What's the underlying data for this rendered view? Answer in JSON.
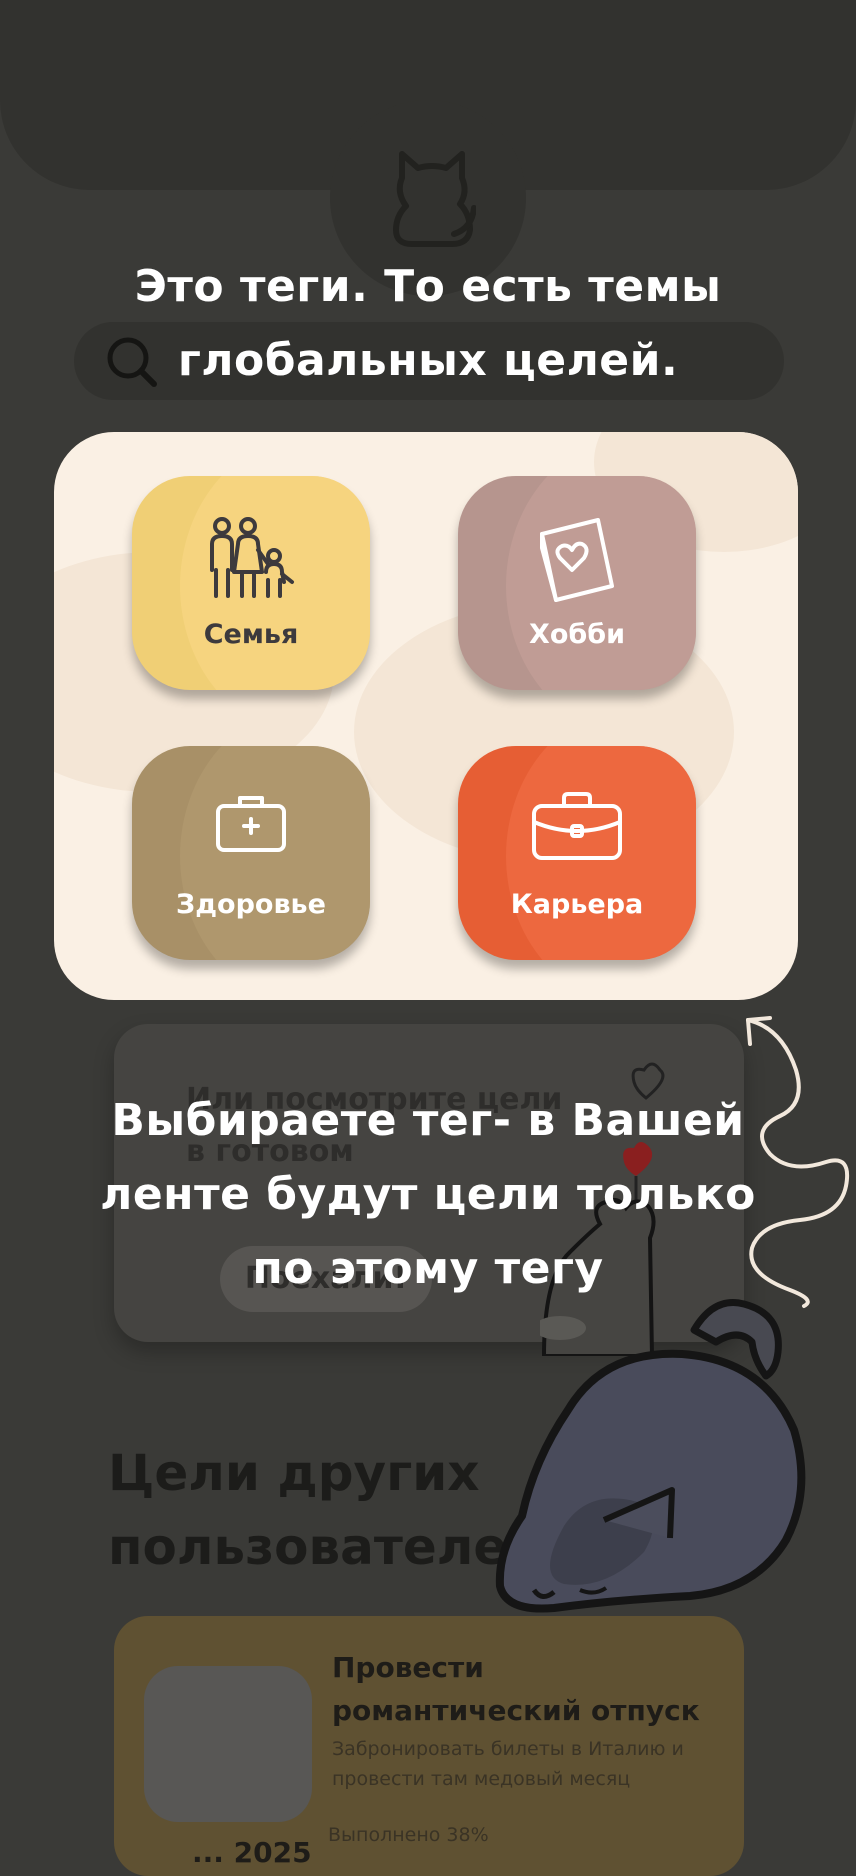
{
  "onboarding": {
    "tip_top": "Это теги. То есть темы глобальных целей.",
    "tip_bottom": "Выбираете тег- в Вашей ленте будут цели только по этому тегу"
  },
  "tags": [
    {
      "label": "Семья",
      "icon": "family-icon"
    },
    {
      "label": "Хобби",
      "icon": "book-heart-icon"
    },
    {
      "label": "Здоровье",
      "icon": "medical-kit-icon"
    },
    {
      "label": "Карьера",
      "icon": "briefcase-icon"
    }
  ],
  "promo": {
    "text": "Или посмотрите цели в готовом",
    "button": "Поехали!"
  },
  "section": {
    "title": "Цели других пользователей"
  },
  "goal_card": {
    "title": "Провести романтический отпуск",
    "description": "Забронировать билеты в Италию и провести там медовый месяц",
    "progress": "Выполнено 38%",
    "date": "... 2025"
  },
  "colors": {
    "overlay_bg": "#3a3a37",
    "panel_bg": "#faf0e4",
    "family": "#f0cf75",
    "hobby": "#b6958e",
    "health": "#a89067",
    "career": "#e65e34"
  }
}
